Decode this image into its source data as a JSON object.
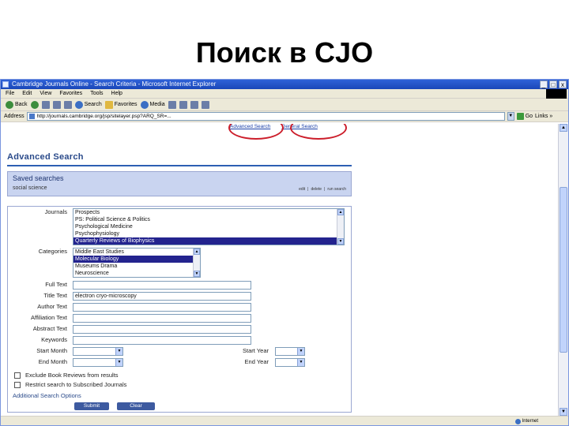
{
  "slide": {
    "title": "Поиск в CJO"
  },
  "browser": {
    "window_title": "Cambridge Journals Online - Search Criteria - Microsoft Internet Explorer",
    "window_buttons": [
      "_",
      "□",
      "x"
    ],
    "menu": [
      "File",
      "Edit",
      "View",
      "Favorites",
      "Tools",
      "Help"
    ],
    "ie_logo": "",
    "toolbar": {
      "back": "Back",
      "search": "Search",
      "favorites": "Favorites",
      "media": "Media"
    },
    "address_label": "Address",
    "url": "http://journals.cambridge.org/jsp/sitelayer.psp?ARQ_SR=...",
    "go": "Go",
    "links": "Links »",
    "status_zone": "Internet"
  },
  "page": {
    "top_links": {
      "advanced": "Advanced Search",
      "general": "General Search"
    },
    "heading": "Advanced Search",
    "saved": {
      "title": "Saved searches",
      "subtitle": "social science",
      "links": [
        "edit",
        "|",
        "delete",
        "|",
        "run search"
      ]
    },
    "form": {
      "labels": {
        "journals": "Journals",
        "categories": "Categories",
        "full_text": "Full Text",
        "title_text": "Title Text",
        "author_text": "Author Text",
        "affiliation_text": "Affiliation Text",
        "abstract_text": "Abstract Text",
        "keywords": "Keywords",
        "start_month": "Start Month",
        "end_month": "End Month",
        "start_year": "Start Year",
        "end_year": "End Year"
      },
      "journals": [
        "Prospects",
        "PS: Political Science & Politics",
        "Psychological Medicine",
        "Psychophysiology",
        "Quarterly Reviews of Biophysics"
      ],
      "journals_selected": 4,
      "categories": [
        "Middle East Studies",
        "Molecular Biology",
        "Museums Drama",
        "Neuroscience"
      ],
      "categories_selected": 1,
      "full_text": "",
      "title_text": "electron cryo-microscopy",
      "author_text": "",
      "affiliation_text": "",
      "abstract_text": "",
      "keywords": "",
      "exclude_book_reviews": "Exclude Book Reviews from results",
      "restrict_subscribed": "Restrict search to Subscribed Journals",
      "additional": "Additional Search Options",
      "submit": "Submit",
      "clear": "Clear"
    }
  },
  "colors": {
    "annotation_circle": "#cc1e2b",
    "selection": "#23238e",
    "heading": "#2a4a8a"
  }
}
